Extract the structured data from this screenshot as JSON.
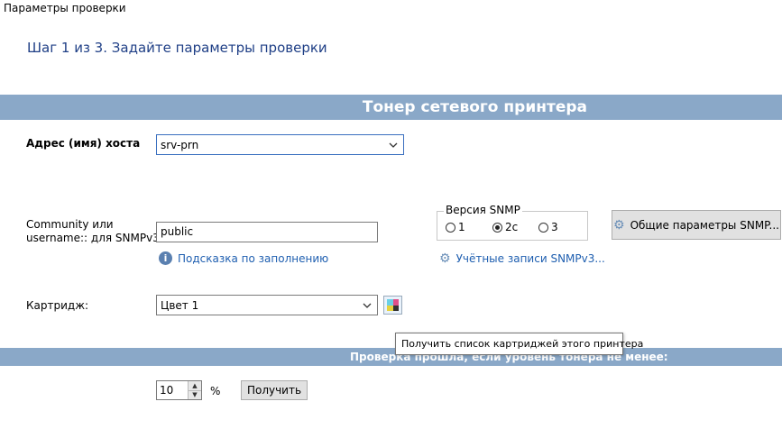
{
  "window": {
    "title": "Параметры проверки"
  },
  "step": {
    "title": "Шаг 1 из 3. Задайте параметры проверки"
  },
  "header_band": {
    "title": "Тонер сетевого принтера"
  },
  "host": {
    "label": "Адрес (имя) хоста",
    "value": "srv-prn"
  },
  "community": {
    "label_line1": "Community или",
    "label_line2": "username:: для SNMPv3",
    "value": "public",
    "hint_link": "Подсказка по заполнению"
  },
  "snmp": {
    "legend": "Версия SNMP",
    "options": [
      "1",
      "2c",
      "3"
    ],
    "selected": "2c",
    "accounts_link": "Учётные записи SNMPv3...",
    "general_button": "Общие параметры SNMP..."
  },
  "cartridge": {
    "label": "Картридж:",
    "value": "Цвет 1",
    "tooltip": "Получить список картриджей этого принтера",
    "icon_colors": [
      "#6ad0e6",
      "#e0508a",
      "#e6d23c",
      "#333333"
    ]
  },
  "threshold": {
    "band_text": "Проверка прошла, если уровень тонера не менее:",
    "value": "10",
    "unit": "%",
    "get_button": "Получить"
  },
  "colors": {
    "band": "#8aa8c8",
    "step_title": "#1f3f86",
    "link": "#1f5fb0"
  }
}
